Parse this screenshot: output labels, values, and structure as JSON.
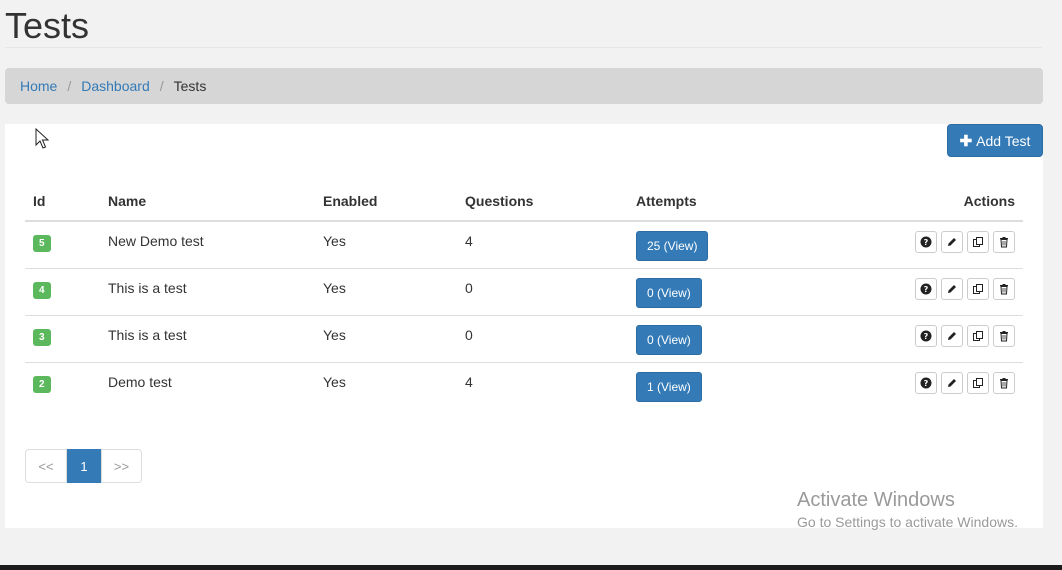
{
  "page": {
    "title": "Tests"
  },
  "breadcrumb": {
    "home": "Home",
    "dashboard": "Dashboard",
    "current": "Tests",
    "separator": "/"
  },
  "toolbar": {
    "add_label": "Add Test",
    "add_icon": "plus-icon"
  },
  "table": {
    "headers": {
      "id": "Id",
      "name": "Name",
      "enabled": "Enabled",
      "questions": "Questions",
      "attempts": "Attempts",
      "actions": "Actions"
    },
    "rows": [
      {
        "id": "5",
        "name": "New Demo test",
        "enabled": "Yes",
        "questions": "4",
        "attempts": "25 (View)"
      },
      {
        "id": "4",
        "name": "This is a test",
        "enabled": "Yes",
        "questions": "0",
        "attempts": "0 (View)"
      },
      {
        "id": "3",
        "name": "This is a test",
        "enabled": "Yes",
        "questions": "0",
        "attempts": "0 (View)"
      },
      {
        "id": "2",
        "name": "Demo test",
        "enabled": "Yes",
        "questions": "4",
        "attempts": "1 (View)"
      }
    ],
    "row_action_icons": [
      "question-icon",
      "pencil-icon",
      "copy-icon",
      "trash-icon"
    ]
  },
  "pagination": {
    "prev": "<<",
    "current": "1",
    "next": ">>"
  },
  "watermark": {
    "line1": "Activate Windows",
    "line2": "Go to Settings to activate Windows."
  },
  "colors": {
    "primary": "#337ab7",
    "success": "#5cb85c",
    "breadcrumb_bg": "#d6d6d6"
  }
}
